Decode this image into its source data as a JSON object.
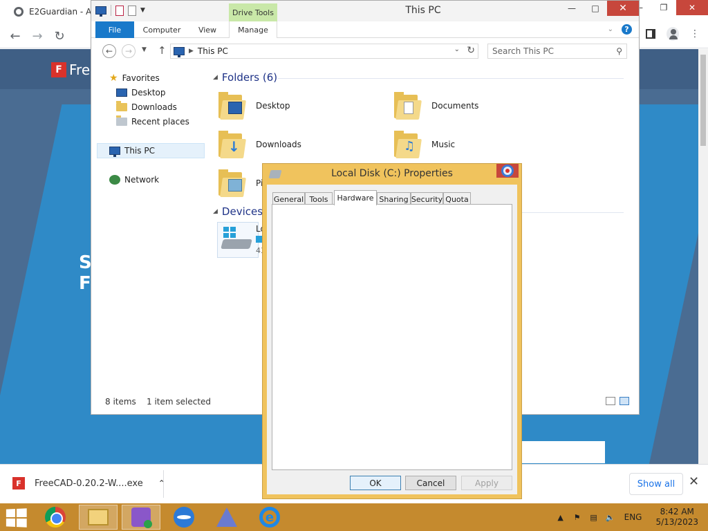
{
  "browser": {
    "tab_title": "E2Guardian - Ac",
    "download": {
      "file_name": "FreeCAD-0.20.2-W....exe",
      "show_all": "Show all"
    },
    "site": {
      "logo_text": "Fre",
      "headline_line1": "S",
      "headline_line2": "F"
    }
  },
  "explorer": {
    "title": "This PC",
    "contextual_tab": "Drive Tools",
    "ribbon_tabs": [
      "File",
      "Computer",
      "View",
      "Manage"
    ],
    "address_path": "This PC",
    "search_placeholder": "Search This PC",
    "nav": {
      "favorites": "Favorites",
      "desktop": "Desktop",
      "downloads": "Downloads",
      "recent_places": "Recent places",
      "this_pc": "This PC",
      "network": "Network"
    },
    "folders_header": "Folders (6)",
    "folders": [
      "Desktop",
      "Documents",
      "Downloads",
      "Music",
      "Pi"
    ],
    "devices_header": "Devices a",
    "drive": {
      "name": "Lo",
      "free": "43",
      "used_fraction": 0.6
    },
    "status": {
      "item_count": "8 items",
      "selection": "1 item selected"
    }
  },
  "dialog": {
    "title": "Local Disk (C:) Properties",
    "tabs": [
      "General",
      "Tools",
      "Hardware",
      "Sharing",
      "Security",
      "Quota"
    ],
    "active_tab": "Hardware",
    "ok": "OK",
    "cancel": "Cancel",
    "apply": "Apply"
  },
  "taskbar": {
    "language": "ENG",
    "time": "8:42 AM",
    "date": "5/13/2023"
  },
  "colors": {
    "dialog_frame": "#f0c35d",
    "taskbar": "#c58a2e",
    "ribbon_file": "#1979ca",
    "drive_tools": "#c9e8a8"
  }
}
